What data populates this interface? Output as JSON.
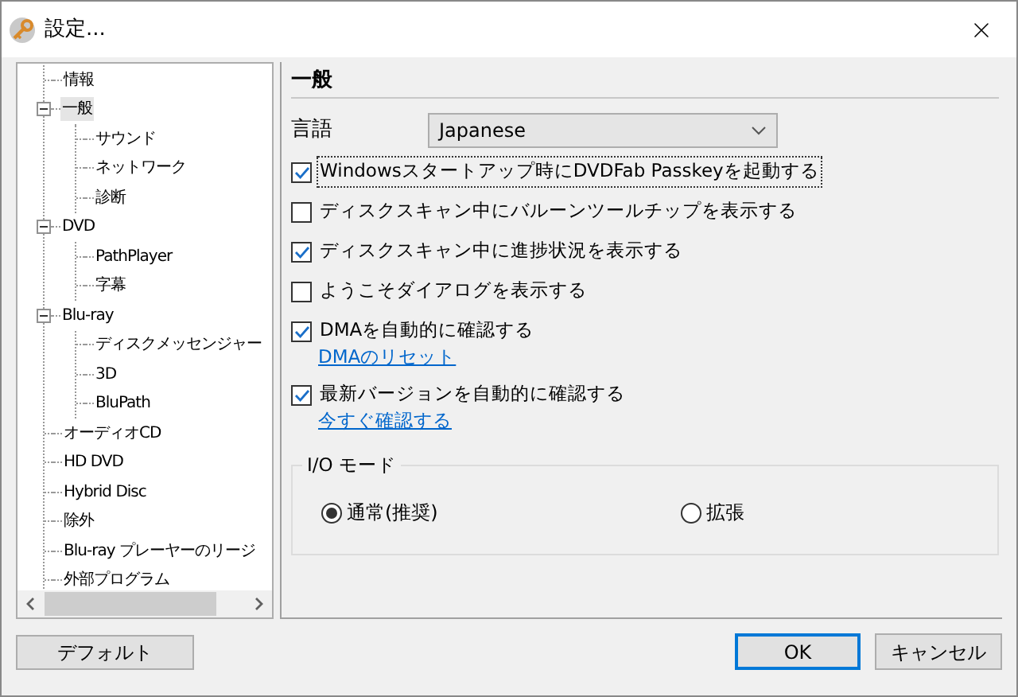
{
  "window": {
    "title": "設定..."
  },
  "tree": [
    {
      "label": "情報",
      "selected": false
    },
    {
      "label": "一般",
      "selected": true,
      "expanded": true,
      "children": [
        {
          "label": "サウンド",
          "selected": false
        },
        {
          "label": "ネットワーク",
          "selected": false
        },
        {
          "label": "診断",
          "selected": false
        }
      ]
    },
    {
      "label": "DVD",
      "selected": false,
      "expanded": true,
      "children": [
        {
          "label": "PathPlayer",
          "selected": false
        },
        {
          "label": "字幕",
          "selected": false
        }
      ]
    },
    {
      "label": "Blu-ray",
      "selected": false,
      "expanded": true,
      "children": [
        {
          "label": "ディスクメッセンジャー",
          "selected": false
        },
        {
          "label": "3D",
          "selected": false
        },
        {
          "label": "BluPath",
          "selected": false
        }
      ]
    },
    {
      "label": "オーディオCD",
      "selected": false
    },
    {
      "label": "HD DVD",
      "selected": false
    },
    {
      "label": "Hybrid Disc",
      "selected": false
    },
    {
      "label": "除外",
      "selected": false
    },
    {
      "label": "Blu-ray プレーヤーのリージ",
      "selected": false
    },
    {
      "label": "外部プログラム",
      "selected": false
    }
  ],
  "panel": {
    "heading": "一般",
    "language": {
      "label": "言語",
      "value": "Japanese"
    },
    "options": [
      {
        "label": "Windowsスタートアップ時にDVDFab Passkeyを起動する",
        "checked": true,
        "focused": true
      },
      {
        "label": "ディスクスキャン中にバルーンツールチップを表示する",
        "checked": false,
        "focused": false
      },
      {
        "label": "ディスクスキャン中に進捗状況を表示する",
        "checked": true,
        "focused": false
      },
      {
        "label": "ようこそダイアログを表示する",
        "checked": false,
        "focused": false
      },
      {
        "label": "DMAを自動的に確認する",
        "checked": true,
        "focused": false,
        "link": "DMAのリセット"
      },
      {
        "label": "最新バージョンを自動的に確認する",
        "checked": true,
        "focused": false,
        "link": "今すぐ確認する"
      }
    ],
    "io_mode": {
      "title": "I/O モード",
      "radios": [
        {
          "label": "通常(推奨)",
          "selected": true
        },
        {
          "label": "拡張",
          "selected": false
        }
      ]
    }
  },
  "buttons": {
    "default": "デフォルト",
    "ok": "OK",
    "cancel": "キャンセル"
  }
}
